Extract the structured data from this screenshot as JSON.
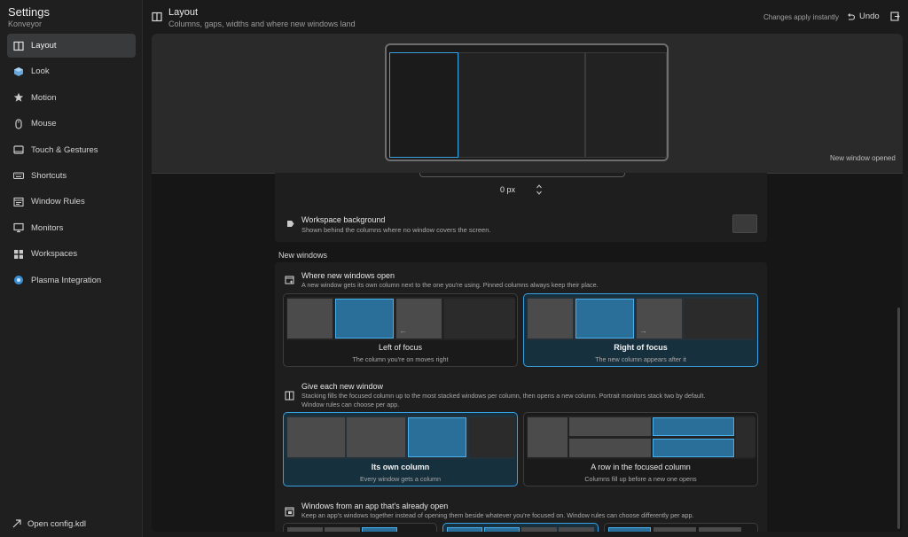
{
  "app": {
    "title": "Settings",
    "subtitle": "Konveyor"
  },
  "sidebar": {
    "items": [
      {
        "label": "Layout",
        "icon": "columns-icon",
        "active": true
      },
      {
        "label": "Look",
        "icon": "cube-icon"
      },
      {
        "label": "Motion",
        "icon": "star-icon"
      },
      {
        "label": "Mouse",
        "icon": "mouse-icon"
      },
      {
        "label": "Touch & Gestures",
        "icon": "touchpad-icon"
      },
      {
        "label": "Shortcuts",
        "icon": "keyboard-icon"
      },
      {
        "label": "Window Rules",
        "icon": "rules-icon"
      },
      {
        "label": "Monitors",
        "icon": "monitor-icon"
      },
      {
        "label": "Workspaces",
        "icon": "grid-icon"
      },
      {
        "label": "Plasma Integration",
        "icon": "plasma-icon"
      }
    ],
    "open_config": "Open config.kdl"
  },
  "header": {
    "title": "Layout",
    "subtitle": "Columns, gaps, widths and where new windows land",
    "status": "Changes apply instantly",
    "undo": "Undo"
  },
  "preview": {
    "caption": "New window opened"
  },
  "gap": {
    "value": "0 px"
  },
  "workspace_background": {
    "title": "Workspace background",
    "desc": "Shown behind the columns where no window covers the screen.",
    "color": "#3a3a3b"
  },
  "new_windows": {
    "section": "New windows",
    "where": {
      "title": "Where new windows open",
      "desc": "A new window gets its own column next to the one you're using. Pinned columns always keep their place.",
      "options": [
        {
          "label": "Left of focus",
          "desc": "The column you're on moves right",
          "selected": false
        },
        {
          "label": "Right of focus",
          "desc": "The new column appears after it",
          "selected": true
        }
      ]
    },
    "give": {
      "title": "Give each new window",
      "desc1": "Stacking fills the focused column up to the most stacked windows per column, then opens a new column. Portrait monitors stack two by default.",
      "desc2": "Window rules can choose per app.",
      "options": [
        {
          "label": "Its own column",
          "desc": "Every window gets a column",
          "selected": true
        },
        {
          "label": "A row in the focused column",
          "desc": "Columns fill up before a new one opens",
          "selected": false
        }
      ]
    },
    "from_app": {
      "title": "Windows from an app that's already open",
      "desc": "Keep an app's windows together instead of opening them beside whatever you're focused on. Window rules can choose differently per app."
    }
  },
  "colors": {
    "accent": "#3aa0e0",
    "selected_bg": "#16303e"
  }
}
